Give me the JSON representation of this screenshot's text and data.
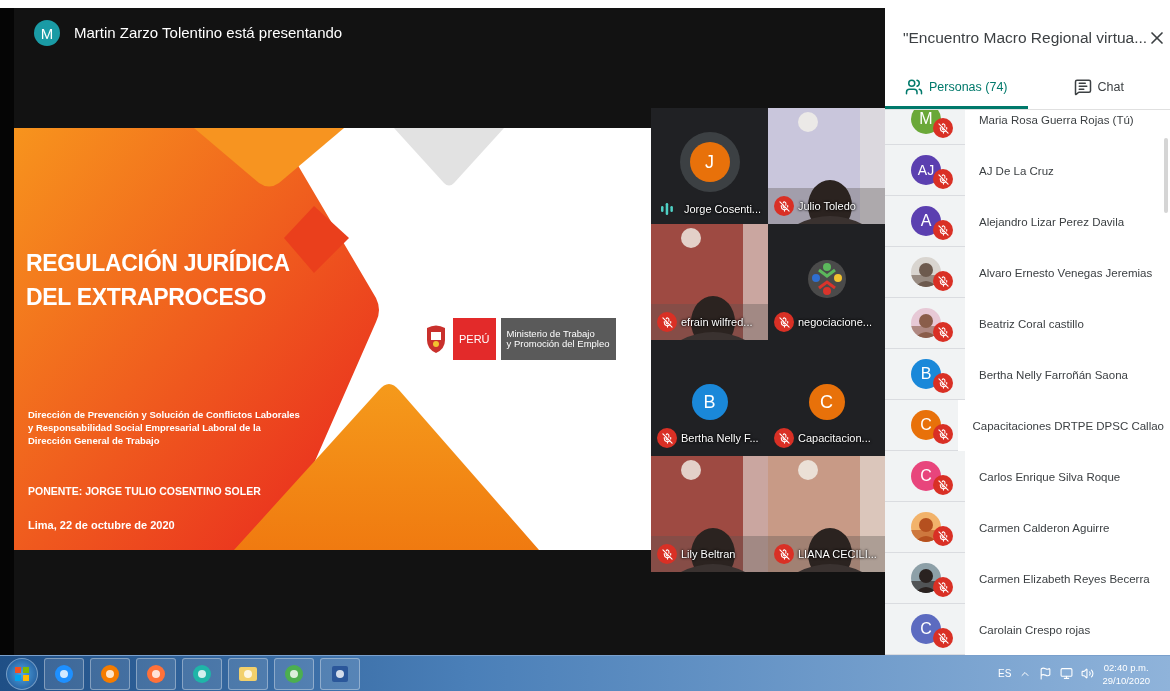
{
  "presenter": {
    "initial": "M",
    "color": "#1a9ba5",
    "text": "Martin Zarzo Tolentino está presentando"
  },
  "slide": {
    "title": [
      "REGULACIÓN JURÍDICA",
      "DEL EXTRAPROCESO"
    ],
    "subtitle": [
      "Dirección de Prevención  y Solución de Conflictos Laborales",
      "y Responsabilidad Social Empresarial Laboral de la",
      "Dirección General de Trabajo"
    ],
    "speaker": "PONENTE: JORGE TULIO COSENTINO SOLER",
    "date": "Lima, 22 de octubre de 2020",
    "logo": {
      "badge": "PERÚ",
      "ministry": [
        "Ministerio de Trabajo",
        "y Promoción del Empleo"
      ]
    }
  },
  "tiles": [
    {
      "kind": "avatar",
      "initial": "J",
      "color": "#e8710a",
      "name": "Jorge Cosenti...",
      "muted": false
    },
    {
      "kind": "video",
      "name": "Julio Toledo",
      "muted": true
    },
    {
      "kind": "video",
      "name": "efrain wilfred...",
      "muted": true
    },
    {
      "kind": "logo",
      "name": "negociacione...",
      "muted": true
    },
    {
      "kind": "avatar",
      "initial": "B",
      "color": "#1a88d9",
      "name": "Bertha Nelly F...",
      "muted": true
    },
    {
      "kind": "avatar",
      "initial": "C",
      "color": "#e8710a",
      "name": "Capacitacion...",
      "muted": true
    },
    {
      "kind": "video",
      "name": "Lily Beltran",
      "muted": true
    },
    {
      "kind": "video",
      "name": "LIANA CECILI...",
      "muted": true
    }
  ],
  "sidebar": {
    "title": "\"Encuentro Macro Regional virtua...",
    "tabs": [
      {
        "label": "Personas (74)",
        "selected": true
      },
      {
        "label": "Chat",
        "selected": false
      }
    ],
    "people": [
      {
        "kind": "letter",
        "initial": "M",
        "color": "#6aa838",
        "name": "Maria Rosa Guerra Rojas (Tú)",
        "muted": true
      },
      {
        "kind": "letter",
        "initial": "AJ",
        "color": "#5b3fb0",
        "name": "AJ De La Cruz",
        "muted": true
      },
      {
        "kind": "letter",
        "initial": "A",
        "color": "#5b3fb0",
        "name": "Alejandro Lizar Perez Davila",
        "muted": true
      },
      {
        "name": "Alvaro Ernesto Venegas Jeremias",
        "muted": true
      },
      {
        "name": "Beatriz Coral castillo",
        "muted": true
      },
      {
        "kind": "letter",
        "initial": "B",
        "color": "#1a88d9",
        "name": "Bertha Nelly Farroñán Saona",
        "muted": true
      },
      {
        "kind": "letter",
        "initial": "C",
        "color": "#e8710a",
        "name": "Capacitaciones DRTPE DPSC Callao",
        "muted": true
      },
      {
        "kind": "letter",
        "initial": "C",
        "color": "#e8457c",
        "name": "Carlos Enrique Silva Roque",
        "muted": true
      },
      {
        "name": "Carmen Calderon Aguirre",
        "muted": true
      },
      {
        "name": "Carmen Elizabeth Reyes Becerra",
        "muted": true
      },
      {
        "kind": "letter",
        "initial": "C",
        "color": "#5c6bc0",
        "name": "Carolain Crespo rojas",
        "muted": true
      }
    ]
  },
  "taskbar": {
    "language": "ES",
    "time": "02:40 p.m.",
    "date": "29/10/2020"
  }
}
